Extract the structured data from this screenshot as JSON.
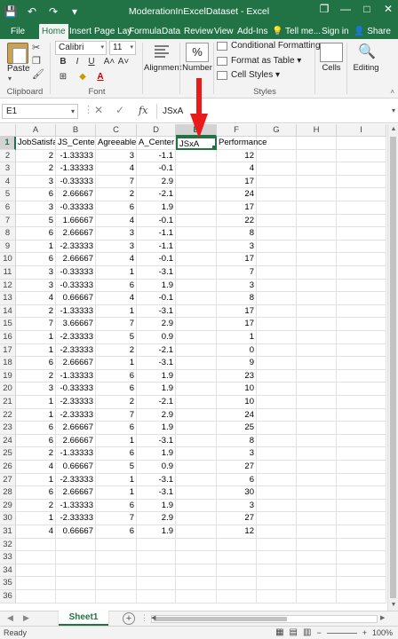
{
  "window": {
    "title": "ModerationInExcelDataset - Excel",
    "help_label": "?",
    "restore_label": "❐",
    "minimize_label": "—",
    "maximize_label": "□",
    "close_label": "✕"
  },
  "qat": {
    "save": "💾",
    "undo": "↶",
    "redo": "↷",
    "customize": "▾"
  },
  "tabs": [
    "File",
    "Home",
    "Insert",
    "Page Lay",
    "Formula",
    "Data",
    "Review",
    "View",
    "Add-Ins"
  ],
  "tab_right": {
    "tellme": "💡 Tell me...",
    "signin": "Sign in",
    "share": "👤 Share"
  },
  "ribbon": {
    "clipboard": {
      "paste": "Paste",
      "label": "Clipboard"
    },
    "font": {
      "name": "Calibri",
      "size": "11",
      "bold": "B",
      "italic": "I",
      "underline": "U",
      "grow": "A˄",
      "shrink": "A˅",
      "label": "Font"
    },
    "alignment": {
      "label": "Alignment"
    },
    "number": {
      "symbol": "%",
      "label": "Number"
    },
    "styles": {
      "conditional": "Conditional Formatting ▾",
      "format_table": "Format as Table ▾",
      "cell_styles": "Cell Styles ▾",
      "label": "Styles"
    },
    "cells": {
      "label": "Cells"
    },
    "editing": {
      "label": "Editing"
    }
  },
  "formula_bar": {
    "name_box": "E1",
    "cancel": "✕",
    "enter": "✓",
    "fx": "fx",
    "content": "JSxA"
  },
  "grid": {
    "columns": [
      "A",
      "B",
      "C",
      "D",
      "E",
      "F",
      "G",
      "H",
      "I"
    ],
    "selected_column": "E",
    "selected_row": 1,
    "headers": [
      "JobSatisfa",
      "JS_Center",
      "Agreeable",
      "A_Center",
      "JSxA",
      "Performance"
    ],
    "rows": [
      [
        "2",
        "-1.33333",
        "3",
        "-1.1",
        "",
        "12"
      ],
      [
        "2",
        "-1.33333",
        "4",
        "-0.1",
        "",
        "4"
      ],
      [
        "3",
        "-0.33333",
        "7",
        "2.9",
        "",
        "17"
      ],
      [
        "6",
        "2.66667",
        "2",
        "-2.1",
        "",
        "24"
      ],
      [
        "3",
        "-0.33333",
        "6",
        "1.9",
        "",
        "17"
      ],
      [
        "5",
        "1.66667",
        "4",
        "-0.1",
        "",
        "22"
      ],
      [
        "6",
        "2.66667",
        "3",
        "-1.1",
        "",
        "8"
      ],
      [
        "1",
        "-2.33333",
        "3",
        "-1.1",
        "",
        "3"
      ],
      [
        "6",
        "2.66667",
        "4",
        "-0.1",
        "",
        "17"
      ],
      [
        "3",
        "-0.33333",
        "1",
        "-3.1",
        "",
        "7"
      ],
      [
        "3",
        "-0.33333",
        "6",
        "1.9",
        "",
        "3"
      ],
      [
        "4",
        "0.66667",
        "4",
        "-0.1",
        "",
        "8"
      ],
      [
        "2",
        "-1.33333",
        "1",
        "-3.1",
        "",
        "17"
      ],
      [
        "7",
        "3.66667",
        "7",
        "2.9",
        "",
        "17"
      ],
      [
        "1",
        "-2.33333",
        "5",
        "0.9",
        "",
        "1"
      ],
      [
        "1",
        "-2.33333",
        "2",
        "-2.1",
        "",
        "0"
      ],
      [
        "6",
        "2.66667",
        "1",
        "-3.1",
        "",
        "9"
      ],
      [
        "2",
        "-1.33333",
        "6",
        "1.9",
        "",
        "23"
      ],
      [
        "3",
        "-0.33333",
        "6",
        "1.9",
        "",
        "10"
      ],
      [
        "1",
        "-2.33333",
        "2",
        "-2.1",
        "",
        "10"
      ],
      [
        "1",
        "-2.33333",
        "7",
        "2.9",
        "",
        "24"
      ],
      [
        "6",
        "2.66667",
        "6",
        "1.9",
        "",
        "25"
      ],
      [
        "6",
        "2.66667",
        "1",
        "-3.1",
        "",
        "8"
      ],
      [
        "2",
        "-1.33333",
        "6",
        "1.9",
        "",
        "3"
      ],
      [
        "4",
        "0.66667",
        "5",
        "0.9",
        "",
        "27"
      ],
      [
        "1",
        "-2.33333",
        "1",
        "-3.1",
        "",
        "6"
      ],
      [
        "6",
        "2.66667",
        "1",
        "-3.1",
        "",
        "30"
      ],
      [
        "2",
        "-1.33333",
        "6",
        "1.9",
        "",
        "3"
      ],
      [
        "1",
        "-2.33333",
        "7",
        "2.9",
        "",
        "27"
      ],
      [
        "4",
        "0.66667",
        "6",
        "1.9",
        "",
        "12"
      ]
    ],
    "row_numbers": [
      "1",
      "2",
      "3",
      "4",
      "5",
      "6",
      "7",
      "8",
      "9",
      "10",
      "11",
      "12",
      "13",
      "14",
      "15",
      "16",
      "17",
      "18",
      "19",
      "20",
      "21",
      "22",
      "23",
      "24",
      "25",
      "26",
      "27",
      "28",
      "29",
      "30",
      "31",
      "32",
      "33",
      "34",
      "35",
      "36"
    ]
  },
  "sheets": {
    "active": "Sheet1",
    "add": "+",
    "prev": "◀",
    "next": "▶"
  },
  "status": {
    "ready": "Ready",
    "zoom": "100%",
    "zoom_minus": "−",
    "zoom_plus": "+"
  },
  "colors": {
    "accent": "#217346",
    "arrow": "#e81a1a"
  }
}
